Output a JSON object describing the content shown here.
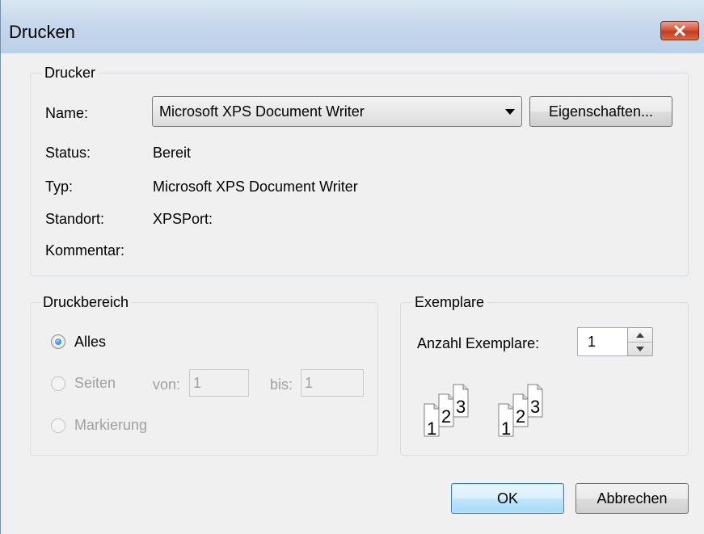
{
  "window": {
    "title": "Drucken"
  },
  "printer_group": {
    "legend": "Drucker",
    "name_label": "Name:",
    "selected_printer": "Microsoft XPS Document Writer",
    "properties_button": "Eigenschaften...",
    "status_label": "Status:",
    "status_value": "Bereit",
    "type_label": "Typ:",
    "type_value": "Microsoft XPS Document Writer",
    "location_label": "Standort:",
    "location_value": "XPSPort:",
    "comment_label": "Kommentar:",
    "comment_value": ""
  },
  "range_group": {
    "legend": "Druckbereich",
    "all_label": "Alles",
    "all_checked": true,
    "pages_label": "Seiten",
    "from_label": "von:",
    "from_value": "1",
    "to_label": "bis:",
    "to_value": "1",
    "selection_label": "Markierung"
  },
  "copies_group": {
    "legend": "Exemplare",
    "count_label": "Anzahl Exemplare:",
    "count_value": "1",
    "collate_pages": [
      "1",
      "2",
      "3"
    ]
  },
  "buttons": {
    "ok": "OK",
    "cancel": "Abbrechen"
  },
  "icons": {
    "close": "close-icon",
    "dropdown": "chevron-down-icon",
    "collate": "collate-pages-icon"
  },
  "colors": {
    "titlebar": "#c3d5ea",
    "close_button": "#c43a1f",
    "ok_border": "#3c7fb1",
    "radio_dot": "#1a62b4"
  }
}
